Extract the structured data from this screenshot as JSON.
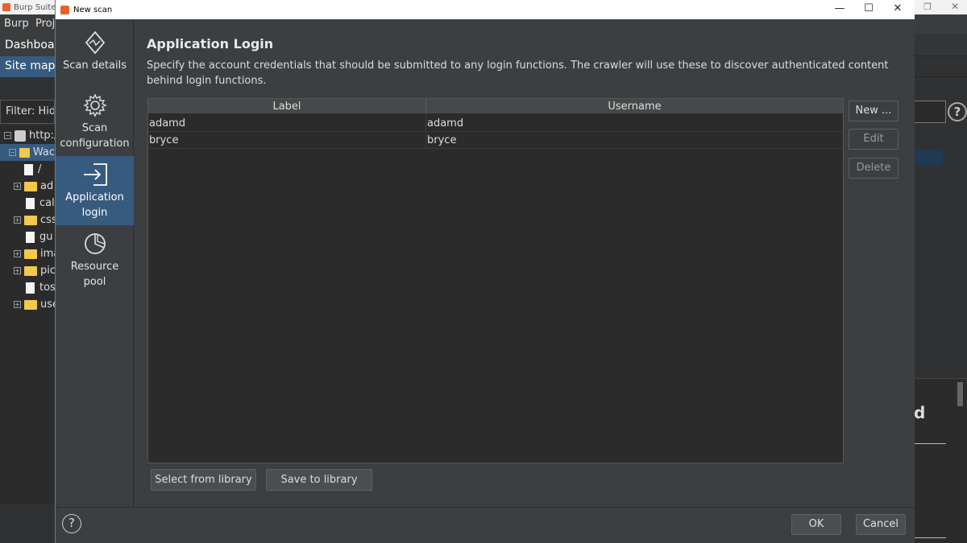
{
  "background": {
    "title": "Burp Suite Pr",
    "menu": [
      "Burp",
      "Proj"
    ],
    "tab_dashboard": "Dashboar",
    "tab_sitemap": "Site map",
    "filter": "Filter: Hid",
    "tree": {
      "root": "http:/",
      "selected": "Wac",
      "slash": "/",
      "items": [
        "ad",
        "cal",
        "css",
        "gu",
        "ima",
        "pic",
        "tos",
        "use"
      ]
    },
    "right_text": "d"
  },
  "dialog": {
    "title": "New scan",
    "sidebar": [
      {
        "label_line1": "Scan details",
        "label_line2": "",
        "icon": "scan-details-icon"
      },
      {
        "label_line1": "Scan",
        "label_line2": "configuration",
        "icon": "gear-icon"
      },
      {
        "label_line1": "Application",
        "label_line2": "login",
        "icon": "login-icon"
      },
      {
        "label_line1": "Resource",
        "label_line2": "pool",
        "icon": "pie-chart-icon"
      }
    ],
    "content": {
      "title": "Application Login",
      "description": "Specify the account credentials that should be submitted to any login functions. The crawler will use these to discover authenticated content behind login functions.",
      "table": {
        "columns": [
          "Label",
          "Username"
        ],
        "rows": [
          [
            "adamd",
            "adamd"
          ],
          [
            "bryce",
            "bryce"
          ]
        ]
      },
      "buttons": {
        "new": "New ...",
        "edit": "Edit",
        "delete": "Delete",
        "select_library": "Select from library",
        "save_library": "Save to library"
      }
    },
    "footer": {
      "help": "?",
      "ok": "OK",
      "cancel": "Cancel"
    }
  }
}
